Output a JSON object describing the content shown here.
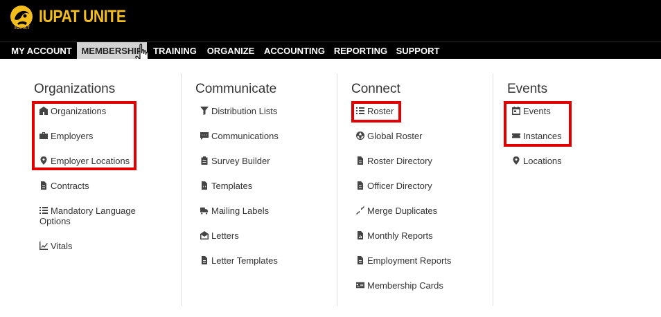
{
  "brand": {
    "name": "IUPAT UNITE",
    "small": "IUPAT",
    "color": "#f3bd1c"
  },
  "nav": {
    "items": [
      "MY ACCOUNT",
      "MEMBERSHIP",
      "TRAINING",
      "ORGANIZE",
      "ACCOUNTING",
      "REPORTING",
      "SUPPORT"
    ],
    "active": "MEMBERSHIP"
  },
  "columns": [
    {
      "title": "Organizations",
      "items": [
        {
          "label": "Organizations",
          "icon": "building-icon"
        },
        {
          "label": "Employers",
          "icon": "briefcase-icon"
        },
        {
          "label": "Employer Locations",
          "icon": "map-pin-icon"
        },
        {
          "label": "Contracts",
          "icon": "file-icon"
        },
        {
          "label": "Mandatory Language Options",
          "icon": "list-icon"
        },
        {
          "label": "Vitals",
          "icon": "chart-line-icon"
        }
      ]
    },
    {
      "title": "Communicate",
      "items": [
        {
          "label": "Distribution Lists",
          "icon": "filter-icon"
        },
        {
          "label": "Communications",
          "icon": "chat-icon"
        },
        {
          "label": "Survey Builder",
          "icon": "clipboard-icon"
        },
        {
          "label": "Templates",
          "icon": "code-file-icon"
        },
        {
          "label": "Mailing Labels",
          "icon": "mail-truck-icon"
        },
        {
          "label": "Letters",
          "icon": "envelope-icon"
        },
        {
          "label": "Letter Templates",
          "icon": "file-text-icon"
        }
      ]
    },
    {
      "title": "Connect",
      "items": [
        {
          "label": "Roster",
          "icon": "list-icon"
        },
        {
          "label": "Global Roster",
          "icon": "globe-icon"
        },
        {
          "label": "Roster Directory",
          "icon": "file-text-icon"
        },
        {
          "label": "Officer Directory",
          "icon": "file-text-icon"
        },
        {
          "label": "Merge Duplicates",
          "icon": "compress-icon"
        },
        {
          "label": "Monthly Reports",
          "icon": "file-chart-icon"
        },
        {
          "label": "Employment Reports",
          "icon": "file-text-icon"
        },
        {
          "label": "Membership Cards",
          "icon": "id-card-icon"
        }
      ]
    },
    {
      "title": "Events",
      "items": [
        {
          "label": "Events",
          "icon": "calendar-icon"
        },
        {
          "label": "Instances",
          "icon": "ticket-icon"
        },
        {
          "label": "Locations",
          "icon": "map-pin-icon"
        }
      ]
    }
  ],
  "highlight_color": "#e00000"
}
